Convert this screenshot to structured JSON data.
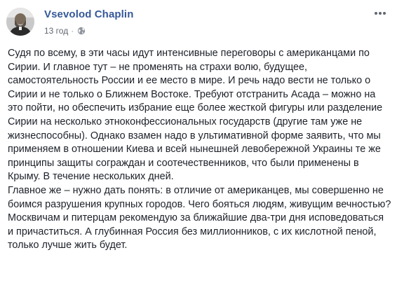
{
  "post": {
    "author": "Vsevolod Chaplin",
    "timestamp": "13 год",
    "separator": "·",
    "privacy_icon": "globe-icon",
    "more_icon": "more-options-icon",
    "link_color": "#365899",
    "text_color": "#1d2129",
    "paragraphs": [
      "Судя по всему, в эти часы идут интенсивные переговоры с американцами по Сирии. И главное тут – не променять на страхи волю, будущее, самостоятельность России и ее место в мире. И речь надо вести не только о Сирии и не только о Ближнем Востоке. Требуют отстранить Асада – можно на это пойти, но обеспечить избрание еще более жесткой фигуры или разделение Сирии на несколько этноконфессиональных государств (другие там уже не жизнеспособны). Однако взамен надо в ультимативной форме заявить, что мы применяем в отношении Киева и всей нынешней левобережной Украины те же принципы защиты сограждан и соотечественников, что были применены в Крыму. В течение нескольких дней.",
      "Главное же – нужно дать понять: в отличие от американцев, мы совершенно не боимся разрушения крупных городов. Чего бояться людям, живущим вечностью? Москвичам и питерцам рекомендую за ближайшие два-три дня исповедоваться и причаститься. А глубинная Россия без миллионников, с их кислотной пеной, только лучше жить будет."
    ]
  }
}
